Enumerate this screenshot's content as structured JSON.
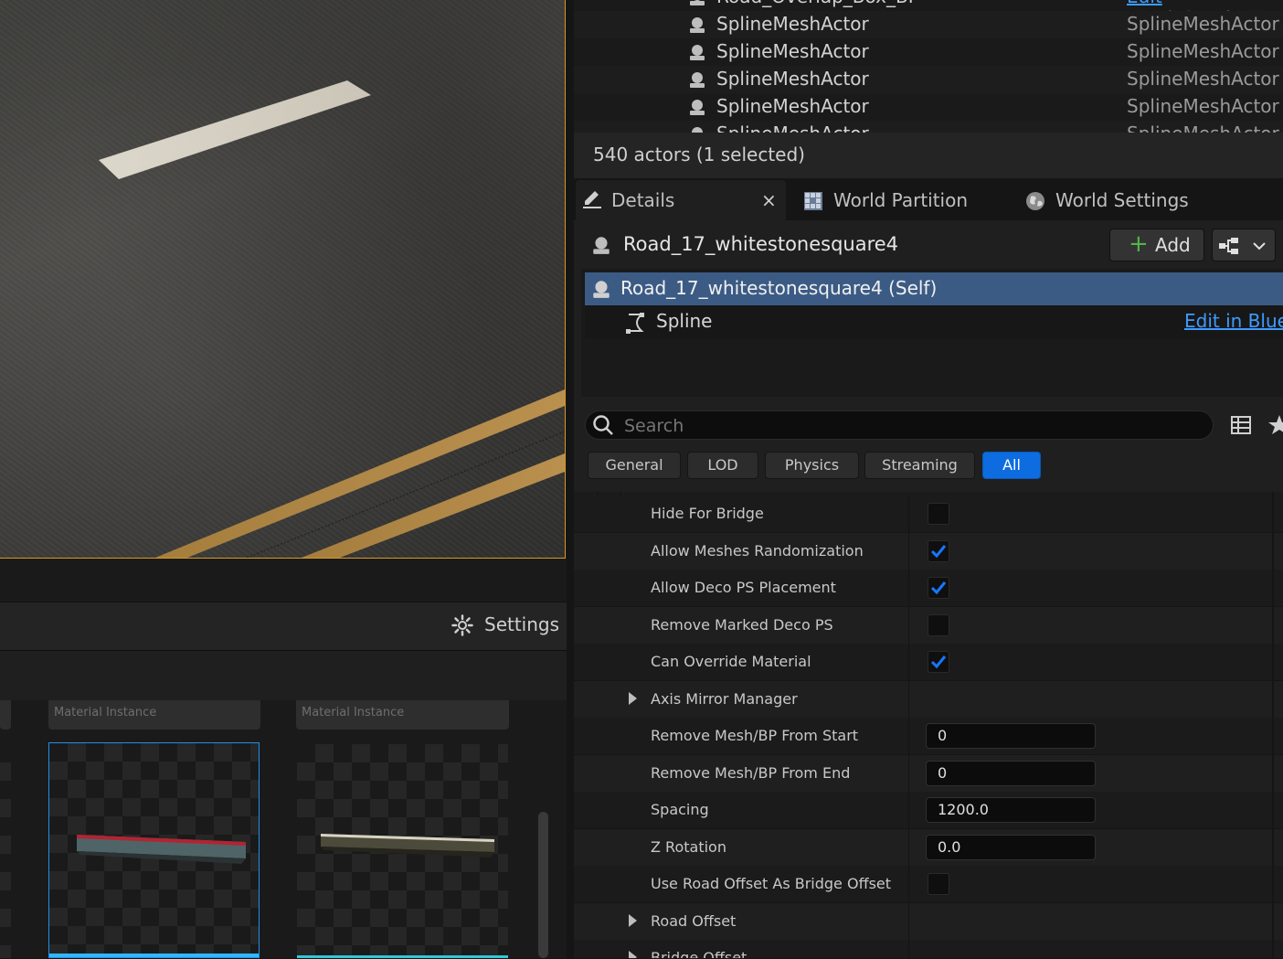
{
  "outliner": {
    "header_partial_name": "Road_Overlap_Box_BP",
    "header_partial_type": "Edit Road_Overlap_",
    "rows": [
      {
        "name": "SplineMeshActor",
        "type": "SplineMeshActor"
      },
      {
        "name": "SplineMeshActor",
        "type": "SplineMeshActor"
      },
      {
        "name": "SplineMeshActor",
        "type": "SplineMeshActor"
      },
      {
        "name": "SplineMeshActor",
        "type": "SplineMeshActor"
      },
      {
        "name": "SplineMeshActor",
        "type": "SplineMeshActor"
      }
    ],
    "footer": "540 actors (1 selected)"
  },
  "tabs": {
    "details": "Details",
    "world_partition": "World Partition",
    "world_settings": "World Settings"
  },
  "details": {
    "actor_name": "Road_17_whitestonesquare4",
    "add_label": "Add",
    "components": [
      {
        "label": "Road_17_whitestonesquare4 (Self)",
        "selected": true
      },
      {
        "label": "Spline",
        "link": "Edit in Bluep"
      }
    ],
    "search_placeholder": "Search",
    "filters": [
      "General",
      "LOD",
      "Physics",
      "Streaming",
      "All"
    ],
    "active_filter": "All",
    "properties": [
      {
        "label": "Hide For Bridge",
        "kind": "check",
        "checked": false
      },
      {
        "label": "Allow Meshes Randomization",
        "kind": "check",
        "checked": true
      },
      {
        "label": "Allow Deco PS Placement",
        "kind": "check",
        "checked": true
      },
      {
        "label": "Remove Marked Deco PS",
        "kind": "check",
        "checked": false
      },
      {
        "label": "Can Override Material",
        "kind": "check",
        "checked": true
      },
      {
        "label": "Axis Mirror Manager",
        "kind": "group"
      },
      {
        "label": "Remove Mesh/BP From Start",
        "kind": "number",
        "value": "0"
      },
      {
        "label": "Remove Mesh/BP From End",
        "kind": "number",
        "value": "0"
      },
      {
        "label": "Spacing",
        "kind": "number",
        "value": "1200.0"
      },
      {
        "label": "Z Rotation",
        "kind": "number",
        "value": "0.0"
      },
      {
        "label": "Use Road Offset As Bridge Offset",
        "kind": "check",
        "checked": false
      },
      {
        "label": "Road Offset",
        "kind": "group"
      },
      {
        "label": "Bridge Offset",
        "kind": "group"
      }
    ]
  },
  "content_browser": {
    "settings_label": "Settings",
    "assets": [
      {
        "type": "Material Instance"
      },
      {
        "type": "Material Instance"
      }
    ]
  },
  "colors": {
    "accent": "#0d6de0",
    "selection": "#3b5b85",
    "viewport_border": "#d99a1c",
    "link": "#3d9bff",
    "check": "#1677ff"
  }
}
